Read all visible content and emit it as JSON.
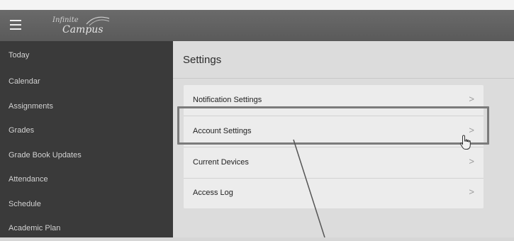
{
  "app": {
    "logo_small": "Infinite",
    "logo_big": "Campus"
  },
  "sidebar": {
    "items": [
      {
        "label": "Today"
      },
      {
        "label": "Calendar"
      },
      {
        "label": "Assignments"
      },
      {
        "label": "Grades"
      },
      {
        "label": "Grade Book Updates"
      },
      {
        "label": "Attendance"
      },
      {
        "label": "Schedule"
      },
      {
        "label": "Academic Plan"
      }
    ]
  },
  "main": {
    "title": "Settings",
    "settings": [
      {
        "label": "Notification Settings",
        "chevron": ">"
      },
      {
        "label": "Account Settings",
        "chevron": ">"
      },
      {
        "label": "Current Devices",
        "chevron": ">"
      },
      {
        "label": "Access Log",
        "chevron": ">"
      }
    ]
  },
  "icons": {
    "menu": "hamburger-menu-icon",
    "pointer": "hand-pointer-icon",
    "chevron": "chevron-right-icon"
  }
}
